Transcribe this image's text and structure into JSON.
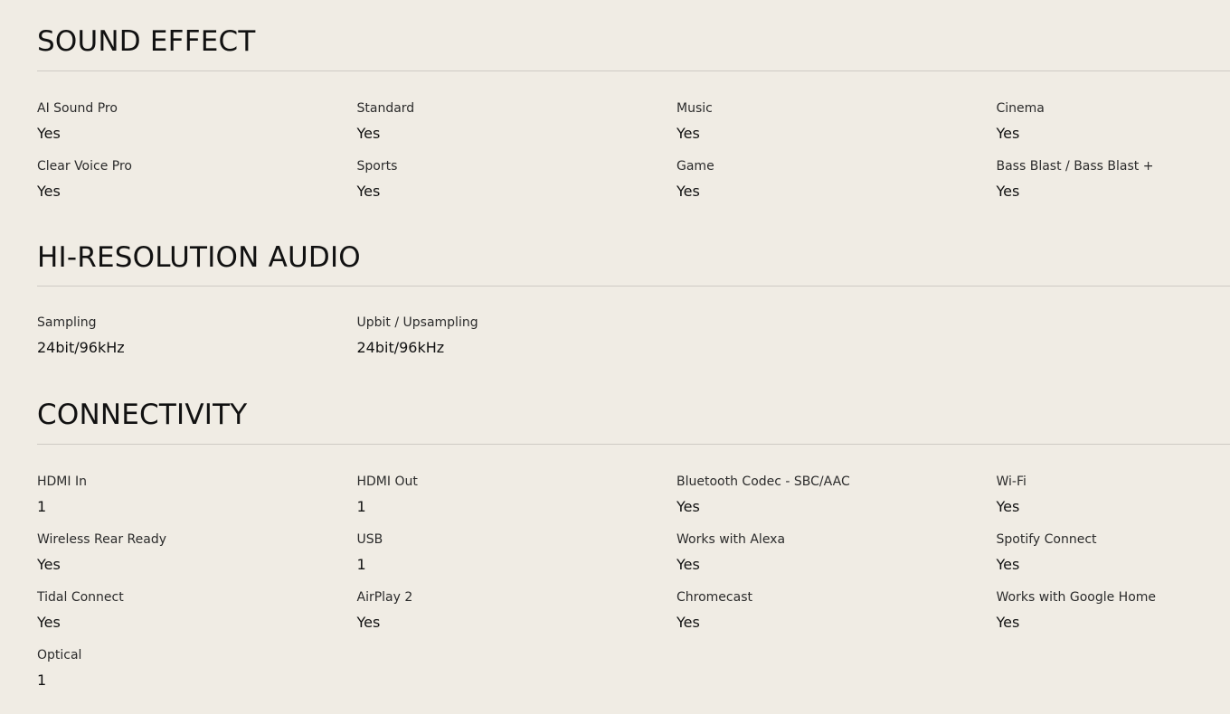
{
  "sections": [
    {
      "title": "SOUND EFFECT",
      "items": [
        {
          "label": "AI Sound Pro",
          "value": "Yes"
        },
        {
          "label": "Standard",
          "value": "Yes"
        },
        {
          "label": "Music",
          "value": "Yes"
        },
        {
          "label": "Cinema",
          "value": "Yes"
        },
        {
          "label": "Clear Voice Pro",
          "value": "Yes"
        },
        {
          "label": "Sports",
          "value": "Yes"
        },
        {
          "label": "Game",
          "value": "Yes"
        },
        {
          "label": "Bass Blast / Bass Blast +",
          "value": "Yes"
        }
      ]
    },
    {
      "title": "HI-RESOLUTION AUDIO",
      "items": [
        {
          "label": "Sampling",
          "value": "24bit/96kHz"
        },
        {
          "label": "Upbit / Upsampling",
          "value": "24bit/96kHz"
        }
      ]
    },
    {
      "title": "CONNECTIVITY",
      "items": [
        {
          "label": "HDMI In",
          "value": "1"
        },
        {
          "label": "HDMI Out",
          "value": "1"
        },
        {
          "label": "Bluetooth Codec - SBC/AAC",
          "value": "Yes"
        },
        {
          "label": "Wi-Fi",
          "value": "Yes"
        },
        {
          "label": "Wireless Rear Ready",
          "value": "Yes"
        },
        {
          "label": "USB",
          "value": "1"
        },
        {
          "label": "Works with Alexa",
          "value": "Yes"
        },
        {
          "label": "Spotify Connect",
          "value": "Yes"
        },
        {
          "label": "Tidal Connect",
          "value": "Yes"
        },
        {
          "label": "AirPlay 2",
          "value": "Yes"
        },
        {
          "label": "Chromecast",
          "value": "Yes"
        },
        {
          "label": "Works with Google Home",
          "value": "Yes"
        },
        {
          "label": "Optical",
          "value": "1"
        }
      ]
    }
  ]
}
